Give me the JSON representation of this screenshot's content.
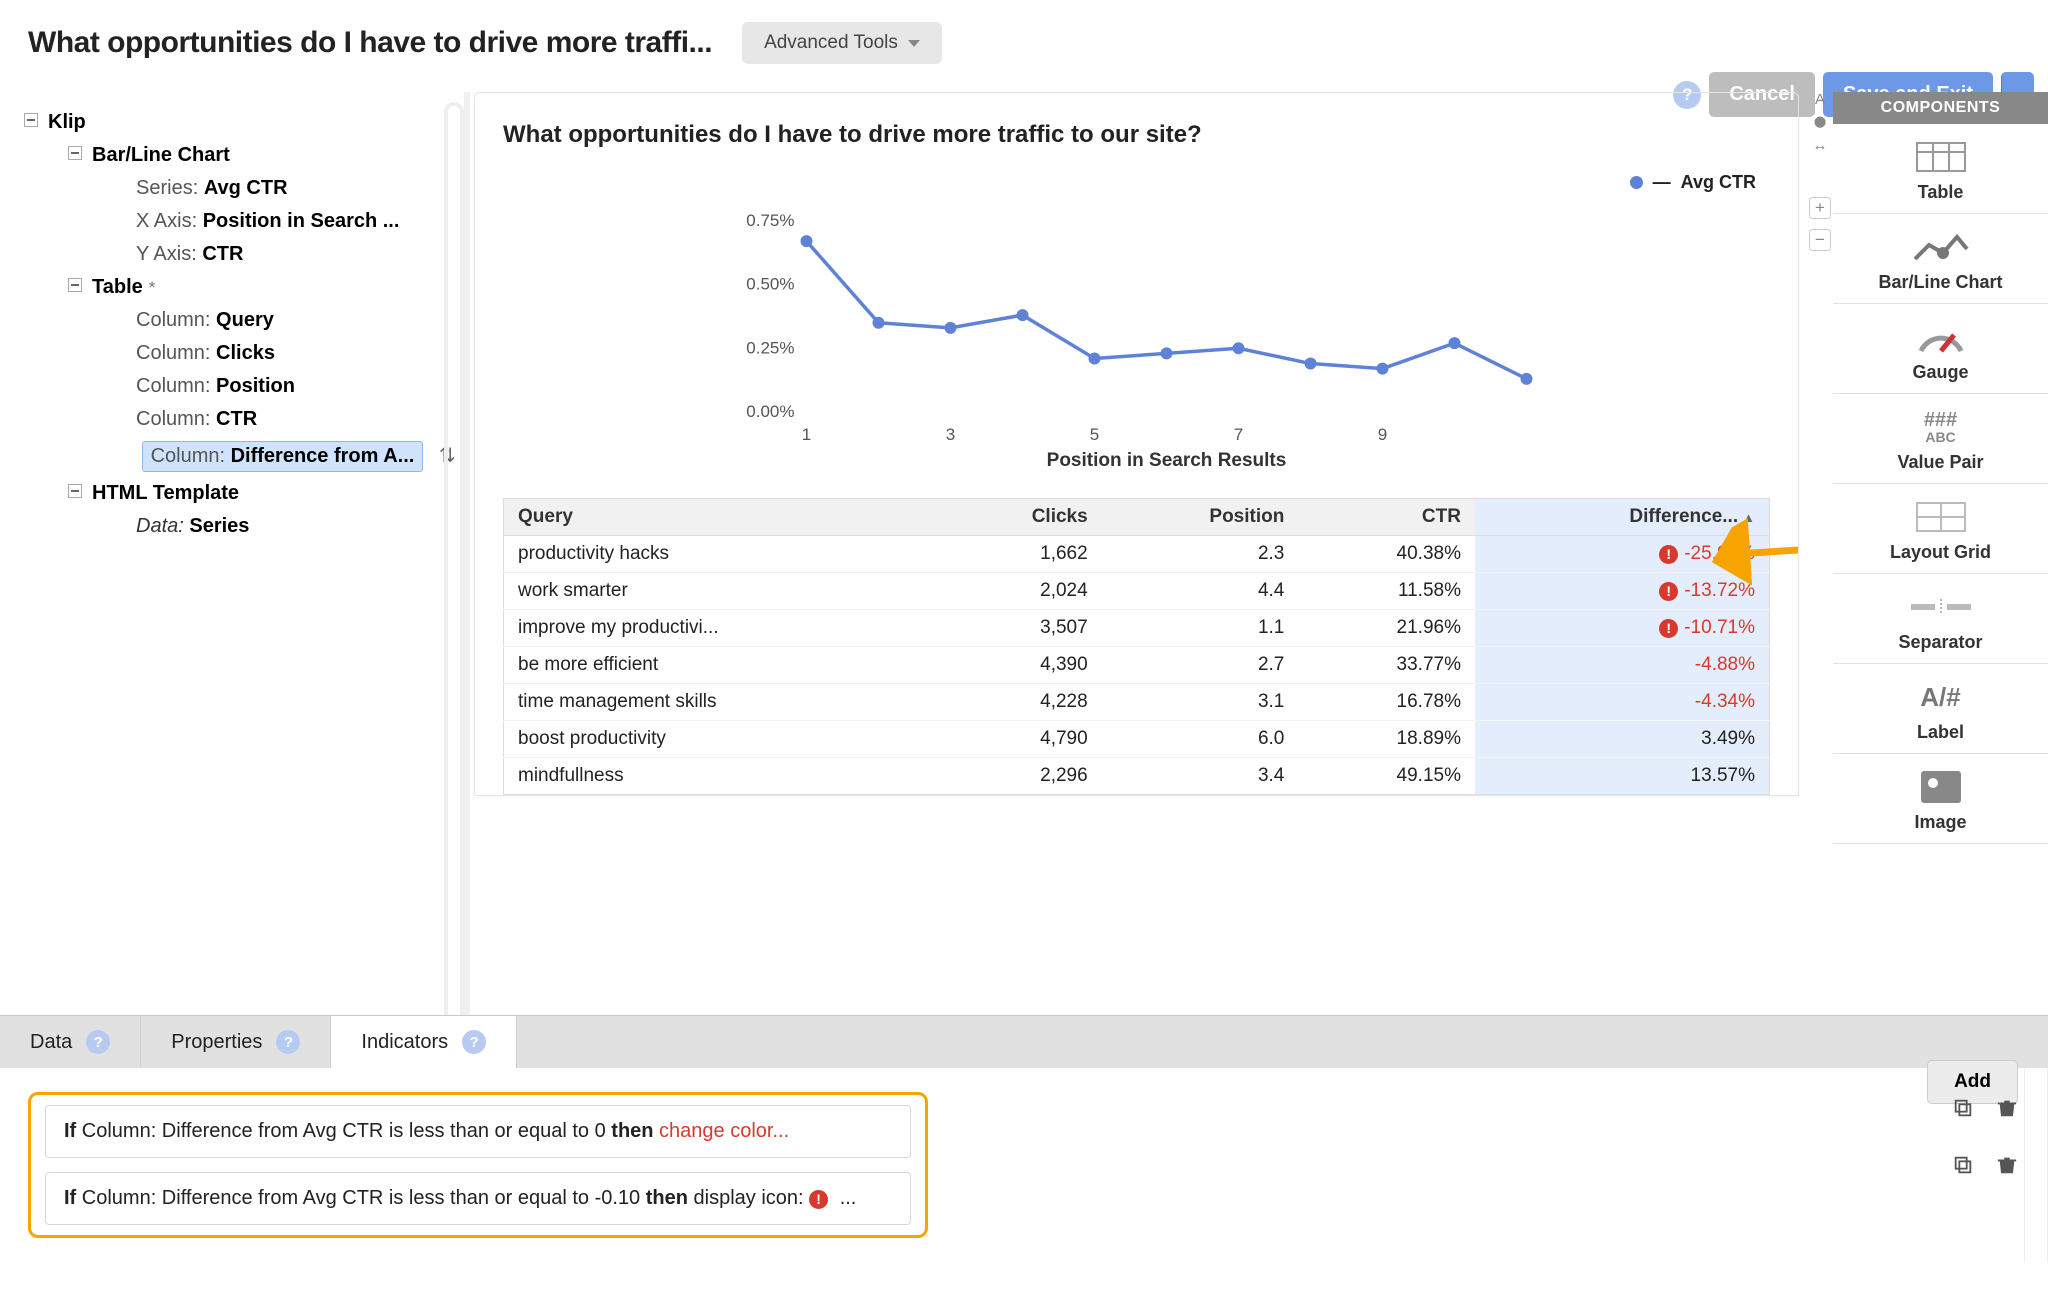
{
  "header": {
    "title": "What opportunities do I have to drive more traffi...",
    "advanced_tools": "Advanced Tools"
  },
  "actions": {
    "cancel": "Cancel",
    "save": "Save and Exit"
  },
  "tree": {
    "root": "Klip",
    "barline": {
      "label": "Bar/Line Chart",
      "series_k": "Series:",
      "series_v": "Avg CTR",
      "xaxis_k": "X Axis:",
      "xaxis_v": "Position in Search ...",
      "yaxis_k": "Y Axis:",
      "yaxis_v": "CTR"
    },
    "table": {
      "label": "Table",
      "dirty": "*",
      "col_k": "Column:",
      "c1": "Query",
      "c2": "Clicks",
      "c3": "Position",
      "c4": "CTR",
      "c5": "Difference from A..."
    },
    "html": {
      "label": "HTML Template",
      "data_k": "Data:",
      "data_v": "Series"
    }
  },
  "preview": {
    "title": "What opportunities do I have to drive more traffic to our site?",
    "legend": "Avg CTR",
    "xlabel": "Position in Search Results",
    "table_headers": [
      "Query",
      "Clicks",
      "Position",
      "CTR",
      "Difference..."
    ],
    "rows": [
      {
        "q": "productivity hacks",
        "clicks": "1,662",
        "pos": "2.3",
        "ctr": "40.38%",
        "diff": "-25.92%",
        "alert": true
      },
      {
        "q": "work smarter",
        "clicks": "2,024",
        "pos": "4.4",
        "ctr": "11.58%",
        "diff": "-13.72%",
        "alert": true
      },
      {
        "q": "improve my productivi...",
        "clicks": "3,507",
        "pos": "1.1",
        "ctr": "21.96%",
        "diff": "-10.71%",
        "alert": true
      },
      {
        "q": "be more efficient",
        "clicks": "4,390",
        "pos": "2.7",
        "ctr": "33.77%",
        "diff": "-4.88%",
        "alert": false
      },
      {
        "q": "time management skills",
        "clicks": "4,228",
        "pos": "3.1",
        "ctr": "16.78%",
        "diff": "-4.34%",
        "alert": false
      },
      {
        "q": "boost productivity",
        "clicks": "4,790",
        "pos": "6.0",
        "ctr": "18.89%",
        "diff": "3.49%",
        "alert": false
      },
      {
        "q": "mindfullness",
        "clicks": "2,296",
        "pos": "3.4",
        "ctr": "49.15%",
        "diff": "13.57%",
        "alert": false
      }
    ]
  },
  "chart_data": {
    "type": "line",
    "title": "What opportunities do I have to drive more traffic to our site?",
    "xlabel": "Position in Search Results",
    "ylabel": "",
    "legend": "Avg CTR",
    "x": [
      1,
      2,
      3,
      4,
      5,
      6,
      7,
      8,
      9,
      10
    ],
    "y_pct": [
      0.67,
      0.35,
      0.33,
      0.38,
      0.21,
      0.23,
      0.25,
      0.19,
      0.17,
      0.27,
      0.13
    ],
    "y_ticks": [
      "0.00%",
      "0.25%",
      "0.50%",
      "0.75%"
    ],
    "x_ticks": [
      "1",
      "3",
      "5",
      "7",
      "9"
    ],
    "ylim": [
      0.0,
      0.8
    ]
  },
  "components": {
    "header": "COMPONENTS",
    "items": [
      "Table",
      "Bar/Line Chart",
      "Gauge",
      "Value Pair",
      "Layout Grid",
      "Separator",
      "Label",
      "Image"
    ]
  },
  "inspector": {
    "tabs": {
      "data": "Data",
      "properties": "Properties",
      "indicators": "Indicators"
    },
    "add": "Add",
    "rule1": {
      "if": "If",
      "col": " Column: Difference from Avg CTR is less than or equal to 0 ",
      "then": "then",
      "action": " change color..."
    },
    "rule2": {
      "if": "If",
      "col": " Column: Difference from Avg CTR is less than or equal to -0.10 ",
      "then": "then",
      "action": " display icon: ",
      "ellipsis": " ..."
    }
  },
  "zoom_icons": [
    "A",
    "⬤",
    "↔"
  ]
}
